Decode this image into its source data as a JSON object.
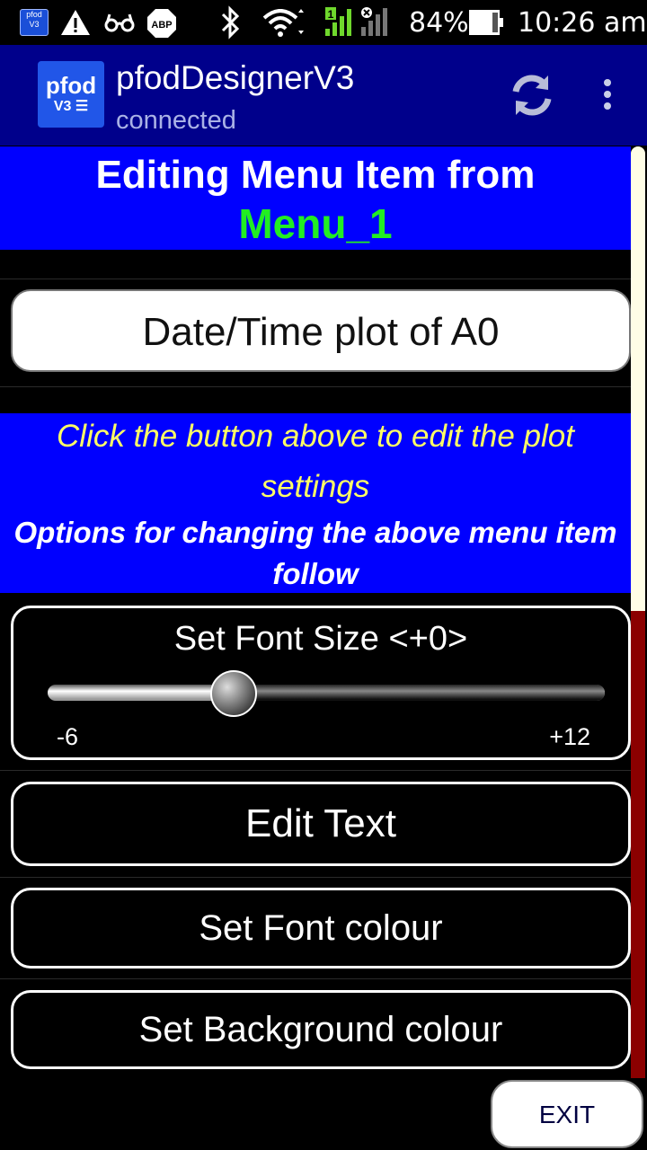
{
  "status_bar": {
    "pfod_icon_top": "pfod",
    "pfod_icon_bottom": "V3",
    "battery": "84%",
    "time": "10:26 am",
    "icons": [
      "warning-icon",
      "glasses-icon",
      "abp-icon",
      "bluetooth-icon",
      "wifi-icon",
      "signal-icon",
      "no-signal-icon",
      "battery-icon"
    ],
    "abp_text": "ABP"
  },
  "action_bar": {
    "icon_big": "pfod",
    "icon_small": "V3",
    "title": "pfodDesignerV3",
    "subtitle": "connected",
    "color": "#00008b"
  },
  "header": {
    "line1": "Editing Menu Item from",
    "line2": "Menu_1",
    "background": "#0000ff",
    "line2_color": "#22ee22"
  },
  "menu_item_button": "Date/Time plot of A0",
  "info": {
    "hint": "Click the button above to edit the plot settings",
    "options": "Options for changing the above menu item follow"
  },
  "font_size": {
    "label": "Set Font Size <+0>",
    "min_label": "-6",
    "max_label": "+12",
    "min": -6,
    "max": 12,
    "value": 0
  },
  "buttons": {
    "edit_text": "Edit Text",
    "font_colour": "Set Font colour",
    "background_colour": "Set Background colour",
    "exit": "EXIT"
  },
  "scrollbar_color": "#8b0000"
}
